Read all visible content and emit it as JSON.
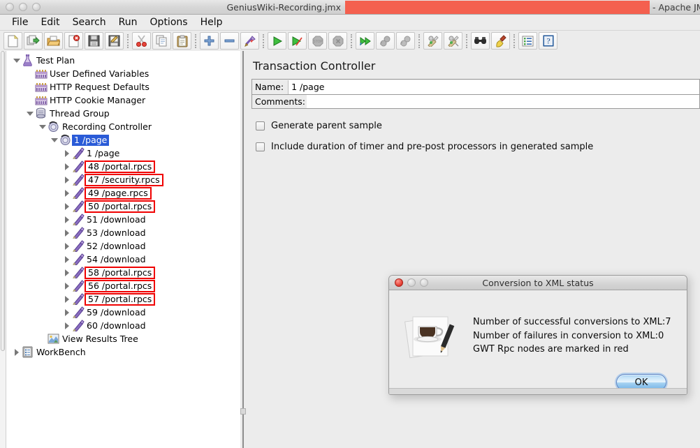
{
  "window": {
    "title_prefix": "GeniusWiki-Recording.jmx",
    "title_suffix": "- Apache JM",
    "redaction_color": "#f4604f"
  },
  "menubar": {
    "items": [
      "File",
      "Edit",
      "Search",
      "Run",
      "Options",
      "Help"
    ]
  },
  "toolbar": {
    "groups": [
      [
        {
          "name": "new-icon",
          "title": "New"
        },
        {
          "name": "templates-icon",
          "title": "Templates"
        },
        {
          "name": "open-icon",
          "title": "Open"
        },
        {
          "name": "close-icon",
          "title": "Close"
        },
        {
          "name": "save-icon",
          "title": "Save"
        },
        {
          "name": "save-as-icon",
          "title": "Save Test Plan as"
        }
      ],
      [
        {
          "name": "cut-icon",
          "title": "Cut"
        },
        {
          "name": "copy-icon",
          "title": "Copy"
        },
        {
          "name": "paste-icon",
          "title": "Paste"
        }
      ],
      [
        {
          "name": "expand-all-icon",
          "title": "Expand All"
        },
        {
          "name": "collapse-all-icon",
          "title": "Collapse All"
        },
        {
          "name": "toggle-icon",
          "title": "Toggle"
        }
      ],
      [
        {
          "name": "start-icon",
          "title": "Start"
        },
        {
          "name": "start-no-pauses-icon",
          "title": "Start no pauses"
        },
        {
          "name": "stop-icon",
          "title": "Stop"
        },
        {
          "name": "shutdown-icon",
          "title": "Shutdown"
        }
      ],
      [
        {
          "name": "remote-start-all-icon",
          "title": "Remote Start All"
        },
        {
          "name": "remote-stop-all-icon",
          "title": "Remote Stop All"
        },
        {
          "name": "remote-shutdown-all-icon",
          "title": "Remote Shutdown All"
        }
      ],
      [
        {
          "name": "clear-icon",
          "title": "Clear"
        },
        {
          "name": "clear-all-icon",
          "title": "Clear All"
        }
      ],
      [
        {
          "name": "search-icon",
          "title": "Search"
        },
        {
          "name": "search-reset-icon",
          "title": "Reset Search"
        }
      ],
      [
        {
          "name": "function-helper-icon",
          "title": "Function Helper Dialog"
        },
        {
          "name": "help-icon",
          "title": "Help"
        }
      ]
    ]
  },
  "tree": {
    "nodes": [
      {
        "label": "Test Plan",
        "indent": 0,
        "twisty": "down",
        "icon": "test-plan-icon",
        "style": "plain"
      },
      {
        "label": "User Defined Variables",
        "indent": 1,
        "twisty": "none",
        "icon": "config-element-icon",
        "style": "plain"
      },
      {
        "label": "HTTP Request Defaults",
        "indent": 1,
        "twisty": "none",
        "icon": "config-element-icon",
        "style": "plain"
      },
      {
        "label": "HTTP Cookie Manager",
        "indent": 1,
        "twisty": "none",
        "icon": "config-element-icon",
        "style": "plain"
      },
      {
        "label": "Thread Group",
        "indent": 1,
        "twisty": "down",
        "icon": "thread-group-icon",
        "style": "plain"
      },
      {
        "label": "Recording Controller",
        "indent": 2,
        "twisty": "down",
        "icon": "controller-icon",
        "style": "plain"
      },
      {
        "label": "1 /page",
        "indent": 3,
        "twisty": "down",
        "icon": "controller-icon",
        "style": "selected"
      },
      {
        "label": "1 /page",
        "indent": 4,
        "twisty": "right",
        "icon": "sampler-icon",
        "style": "plain"
      },
      {
        "label": "48 /portal.rpcs",
        "indent": 4,
        "twisty": "right",
        "icon": "sampler-icon",
        "style": "redbox"
      },
      {
        "label": "47 /security.rpcs",
        "indent": 4,
        "twisty": "right",
        "icon": "sampler-icon",
        "style": "redbox"
      },
      {
        "label": "49 /page.rpcs",
        "indent": 4,
        "twisty": "right",
        "icon": "sampler-icon",
        "style": "redbox"
      },
      {
        "label": "50 /portal.rpcs",
        "indent": 4,
        "twisty": "right",
        "icon": "sampler-icon",
        "style": "redbox"
      },
      {
        "label": "51 /download",
        "indent": 4,
        "twisty": "right",
        "icon": "sampler-icon",
        "style": "plain"
      },
      {
        "label": "53 /download",
        "indent": 4,
        "twisty": "right",
        "icon": "sampler-icon",
        "style": "plain"
      },
      {
        "label": "52 /download",
        "indent": 4,
        "twisty": "right",
        "icon": "sampler-icon",
        "style": "plain"
      },
      {
        "label": "54 /download",
        "indent": 4,
        "twisty": "right",
        "icon": "sampler-icon",
        "style": "plain"
      },
      {
        "label": "58 /portal.rpcs",
        "indent": 4,
        "twisty": "right",
        "icon": "sampler-icon",
        "style": "redbox"
      },
      {
        "label": "56 /portal.rpcs",
        "indent": 4,
        "twisty": "right",
        "icon": "sampler-icon",
        "style": "redbox"
      },
      {
        "label": "57 /portal.rpcs",
        "indent": 4,
        "twisty": "right",
        "icon": "sampler-icon",
        "style": "redbox"
      },
      {
        "label": "59 /download",
        "indent": 4,
        "twisty": "right",
        "icon": "sampler-icon",
        "style": "plain"
      },
      {
        "label": "60 /download",
        "indent": 4,
        "twisty": "right",
        "icon": "sampler-icon",
        "style": "plain"
      },
      {
        "label": "View Results Tree",
        "indent": 2,
        "twisty": "none",
        "icon": "listener-icon",
        "style": "plain"
      },
      {
        "label": "WorkBench",
        "indent": 0,
        "twisty": "right",
        "icon": "workbench-icon",
        "style": "plain"
      }
    ]
  },
  "editor": {
    "title": "Transaction Controller",
    "name_label": "Name:",
    "name_value": "1 /page",
    "comments_label": "Comments:",
    "comments_value": "",
    "checkboxes": [
      {
        "label": "Generate parent sample",
        "checked": false
      },
      {
        "label": "Include duration of timer and pre-post processors in generated sample",
        "checked": false
      }
    ]
  },
  "dialog": {
    "title": "Conversion to XML status",
    "lines": [
      "Number of successful conversions to XML:7",
      "Number of failures in conversion to XML:0",
      "GWT Rpc nodes are marked in red"
    ],
    "line1": "Number of successful conversions to XML:7",
    "line2": "Number of failures in conversion to XML:0",
    "line3": "GWT Rpc nodes are marked in red",
    "ok_label": "OK",
    "icon": "coffee-document-icon"
  }
}
